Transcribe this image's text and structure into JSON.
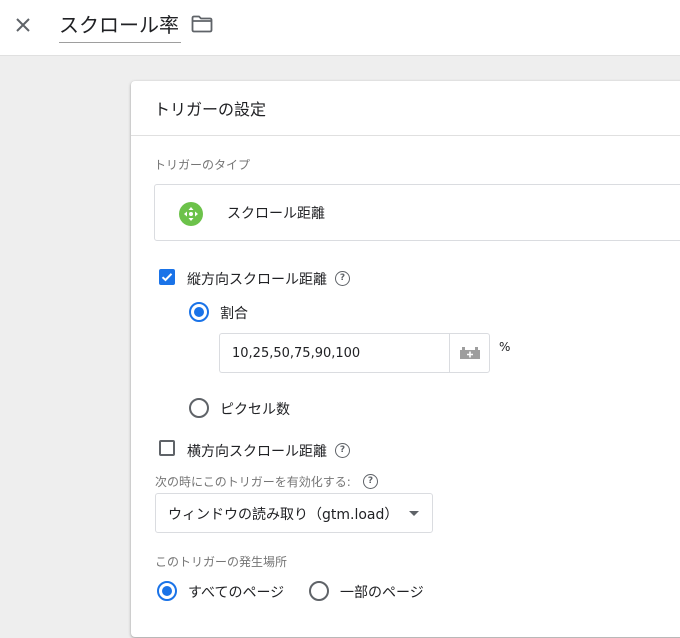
{
  "header": {
    "title": "スクロール率"
  },
  "card": {
    "title": "トリガーの設定",
    "trigger_type_label": "トリガーのタイプ",
    "trigger_type_name": "スクロール距離",
    "trigger_type_icon": "move-arrows-icon",
    "accent_color": "#1a73e8",
    "icon_color": "#6cc24a",
    "vertical": {
      "label": "縦方向スクロール距離",
      "checked": true,
      "options": [
        {
          "label": "割合",
          "selected": true
        },
        {
          "label": "ピクセル数",
          "selected": false
        }
      ],
      "percent_value": "10,25,50,75,90,100",
      "percent_unit": "%"
    },
    "horizontal": {
      "label": "横方向スクロール距離",
      "checked": false
    },
    "enable_when": {
      "label": "次の時にこのトリガーを有効化する:",
      "selected": "ウィンドウの読み取り（gtm.load）"
    },
    "fire_on": {
      "label": "このトリガーの発生場所",
      "options": [
        {
          "label": "すべてのページ",
          "selected": true
        },
        {
          "label": "一部のページ",
          "selected": false
        }
      ]
    }
  }
}
